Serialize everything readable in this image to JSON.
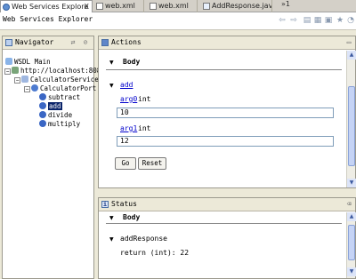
{
  "tabs": [
    {
      "label": "Web Services Explore",
      "active": true,
      "close": "X"
    },
    {
      "label": "web.xml"
    },
    {
      "label": "web.xml"
    },
    {
      "label": "AddResponse.java"
    }
  ],
  "tabs_overflow": "»1",
  "header": {
    "title": "Web Services Explorer"
  },
  "navigator": {
    "title": "Navigator",
    "tree": {
      "wsdl_main": "WSDL Main",
      "url": "http://localhost:808",
      "service": "CalculatorService",
      "port": "CalculatorPort",
      "ops": [
        "subtract",
        "add",
        "divide",
        "multiply"
      ]
    }
  },
  "actions": {
    "title": "Actions",
    "body_label": "Body",
    "operation": "add",
    "arg0_name": "arg0",
    "arg0_type": "int",
    "arg0_value": "10",
    "arg1_name": "arg1",
    "arg1_type": "int",
    "arg1_value": "12",
    "go_label": "Go",
    "reset_label": "Reset"
  },
  "status": {
    "title": "Status",
    "body_label": "Body",
    "response_label": "addResponse",
    "return_text": "return (int): 22"
  },
  "colors": {
    "selection": "#0a246a",
    "link": "#0000cc"
  }
}
